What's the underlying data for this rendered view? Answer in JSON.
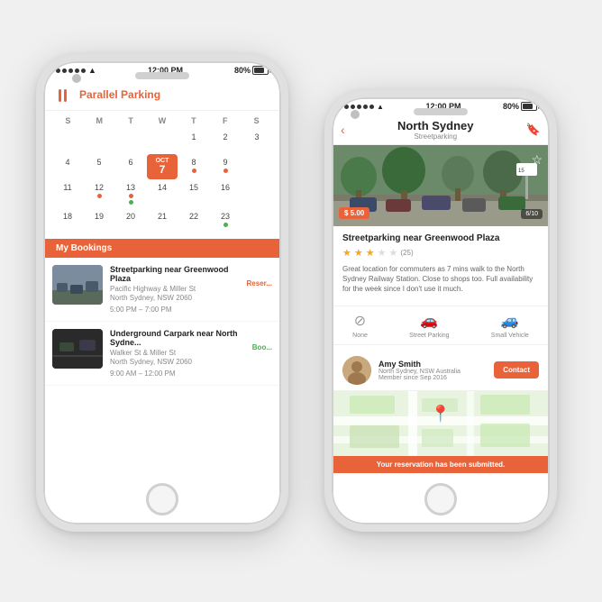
{
  "colors": {
    "accent": "#e8623a",
    "green": "#4caf50",
    "text_dark": "#222",
    "text_mid": "#666",
    "text_light": "#888"
  },
  "phone1": {
    "status": {
      "time": "12:00 PM",
      "battery": "80%"
    },
    "app": {
      "brand": "Parallel",
      "brand_colored": "Parking"
    },
    "calendar": {
      "days": [
        "S",
        "M",
        "T",
        "W",
        "T",
        "F",
        "S"
      ],
      "month": "OCT",
      "today_num": "7",
      "rows": [
        [
          "",
          "",
          "",
          "",
          "1",
          "2",
          "3"
        ],
        [
          "4",
          "5",
          "6",
          "",
          "8",
          "9",
          ""
        ],
        [
          "11",
          "12",
          "13",
          "14",
          "15",
          "16",
          ""
        ],
        [
          "18",
          "19",
          "20",
          "21",
          "22",
          "23",
          ""
        ]
      ]
    },
    "bookings_header": "My Bookings",
    "bookings": [
      {
        "title": "Streetparking near Greenwood Plaza",
        "address_line1": "Pacific Highway & Miller St",
        "address_line2": "North Sydney, NSW 2060",
        "time": "5:00 PM – 7:00 PM",
        "action": "Reser..."
      },
      {
        "title": "Underground Carpark near North Sydne...",
        "address_line1": "Walker St & Miller St",
        "address_line2": "North Sydney, NSW 2060",
        "time": "9:00 AM – 12:00 PM",
        "action": "Boo..."
      }
    ]
  },
  "phone2": {
    "status": {
      "time": "12:00 PM",
      "battery": "80%"
    },
    "header": {
      "title": "North Sydney",
      "subtitle": "Streetparking",
      "back_label": "‹",
      "bookmark_label": "🔖"
    },
    "image": {
      "price": "$ 5.00",
      "counter": "6/10"
    },
    "detail": {
      "title": "Streetparking near Greenwood Plaza",
      "stars": 3,
      "max_stars": 5,
      "review_count": "(25)",
      "description": "Great location for commuters as 7 mins walk to the North Sydney Railway Station. Close to shops too. Full availability for the week since I don't use it much."
    },
    "features": [
      {
        "icon": "⊘",
        "label": "None"
      },
      {
        "icon": "🚗",
        "label": "Street Parking"
      },
      {
        "icon": "🚙",
        "label": "Small Vehicle"
      }
    ],
    "host": {
      "name": "Amy Smith",
      "location": "North Sydney, NSW Australia",
      "member_since": "Member since Sep 2016",
      "contact_label": "Contact"
    },
    "toast": "Your reservation has been submitted."
  }
}
